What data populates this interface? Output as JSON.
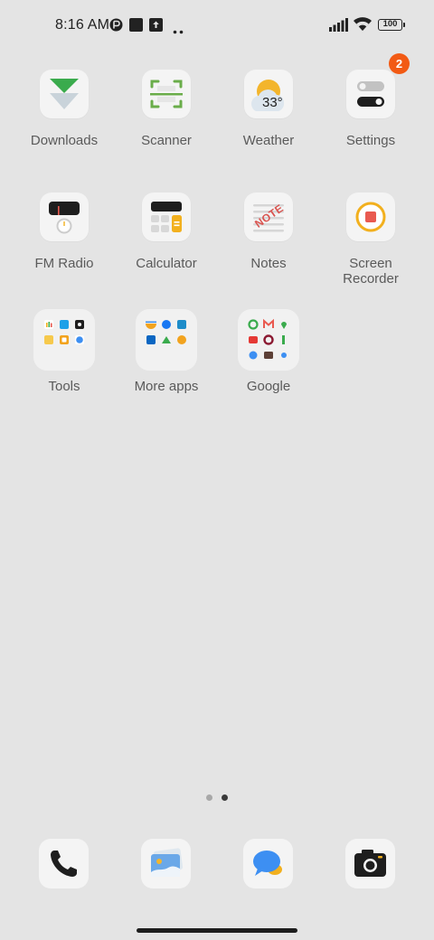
{
  "status_bar": {
    "time": "8:16 AM",
    "battery": "100",
    "left_icons": [
      "vpn-icon",
      "square-icon",
      "upload-icon",
      "more-dots-icon"
    ],
    "right_icons": [
      "signal-icon",
      "wifi-icon",
      "battery-icon"
    ]
  },
  "apps": [
    {
      "label": "Downloads",
      "icon": "downloads-icon"
    },
    {
      "label": "Scanner",
      "icon": "scanner-icon"
    },
    {
      "label": "Weather",
      "icon": "weather-icon",
      "temperature": "33°"
    },
    {
      "label": "Settings",
      "icon": "settings-icon",
      "badge": "2"
    },
    {
      "label": "FM Radio",
      "icon": "radio-icon"
    },
    {
      "label": "Calculator",
      "icon": "calculator-icon"
    },
    {
      "label": "Notes",
      "icon": "notes-icon",
      "icon_text": "NOTE"
    },
    {
      "label": "Screen Recorder",
      "icon": "screen-recorder-icon"
    }
  ],
  "folders": [
    {
      "label": "Tools"
    },
    {
      "label": "More apps"
    },
    {
      "label": "Google"
    }
  ],
  "page_indicator": {
    "pages": 2,
    "current": 2
  },
  "dock": [
    {
      "name": "Phone",
      "icon": "phone-icon"
    },
    {
      "name": "Gallery",
      "icon": "gallery-icon"
    },
    {
      "name": "Messages",
      "icon": "messages-icon"
    },
    {
      "name": "Camera",
      "icon": "camera-icon"
    }
  ],
  "colors": {
    "background": "#e4e4e4",
    "badge": "#f25a14",
    "label": "#5a5a5a",
    "downloads_green": "#3aab4d",
    "scanner_green": "#6aad4a",
    "weather_sun": "#f3b52c",
    "recorder_ring": "#f2b01e",
    "recorder_stop": "#e95a50",
    "messages_blue": "#3d8ff2"
  }
}
